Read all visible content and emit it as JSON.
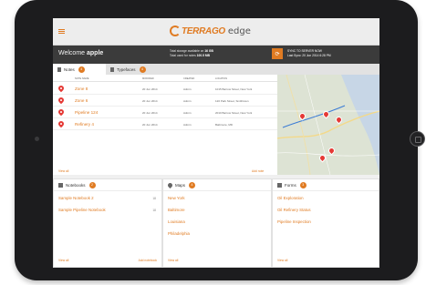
{
  "app": {
    "logo_text": "TERRAGO",
    "logo_suffix": "edge"
  },
  "welcome": {
    "label": "Welcome",
    "user": "apple"
  },
  "storage": {
    "line1_label": "Total storage available on",
    "line1_value": "16 GB",
    "line2_label": "Total used for notes",
    "line2_value": "100.5 MB"
  },
  "sync": {
    "icon": "sync-icon",
    "label": "SYNC TO SERVER NOW",
    "last": "Last Sync: 20 Jun 2014 6:28 PM"
  },
  "tabs": [
    {
      "label": "Notes",
      "badge": "4",
      "icon": "notes-icon"
    },
    {
      "label": "Typefaces",
      "badge": "4",
      "icon": "typefaces-icon"
    }
  ],
  "table": {
    "columns": [
      "Note Name",
      "Modified",
      "Created",
      "Location"
    ],
    "rows": [
      {
        "name": "Zone 8",
        "modified": "20 Jun 2014",
        "created": "Admin",
        "location": "1015 Barrow Street, New York"
      },
      {
        "name": "Zone 6",
        "modified": "20 Jun 2014",
        "created": "Admin",
        "location": "120 Park Street, Smithtown"
      },
      {
        "name": "Pipeline 124",
        "modified": "20 Jun 2014",
        "created": "Admin",
        "location": "2010 Barrow Street, New York"
      },
      {
        "name": "Refinery 4",
        "modified": "20 Jun 2014",
        "created": "Admin",
        "location": "Baltimore, MD"
      }
    ],
    "view_all": "View all",
    "add_note": "Add note"
  },
  "notebooks": {
    "title": "Notebooks",
    "badge": "2",
    "icon": "notebook-icon",
    "items": [
      {
        "label": "Sample Notebook 2",
        "count": "18"
      },
      {
        "label": "Sample Pipeline Notebook",
        "count": "18"
      }
    ],
    "view_all": "View all",
    "add": "Add notebook"
  },
  "maps": {
    "title": "Maps",
    "badge": "4",
    "icon": "map-pin-icon",
    "items": [
      "New York",
      "Baltimore",
      "Louisiana",
      "Philadelphia"
    ],
    "view_all": "View all"
  },
  "forms": {
    "title": "Forms",
    "badge": "3",
    "icon": "forms-icon",
    "items": [
      "Oil Exploration",
      "Oil Refinery Status",
      "Pipeline Inspection"
    ],
    "view_all": "View all"
  },
  "colors": {
    "accent": "#e07b22",
    "pin": "#e53935",
    "dark_bar": "#3b3b3b"
  }
}
